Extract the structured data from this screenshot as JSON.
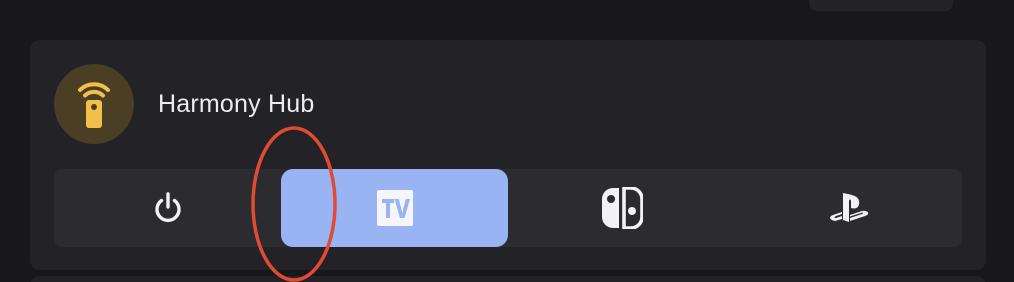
{
  "card": {
    "title": "Harmony Hub",
    "avatar_icon": "remote-wifi-icon",
    "avatar_icon_color": "#f2c04a",
    "avatar_bg": "#4a3f25"
  },
  "activities": [
    {
      "icon": "power-icon",
      "selected": false
    },
    {
      "icon": "tv-icon",
      "selected": true
    },
    {
      "icon": "nintendo-switch-icon",
      "selected": false
    },
    {
      "icon": "playstation-icon",
      "selected": false
    }
  ],
  "colors": {
    "accent": "#99b4f2",
    "annotation": "#e04b32"
  }
}
